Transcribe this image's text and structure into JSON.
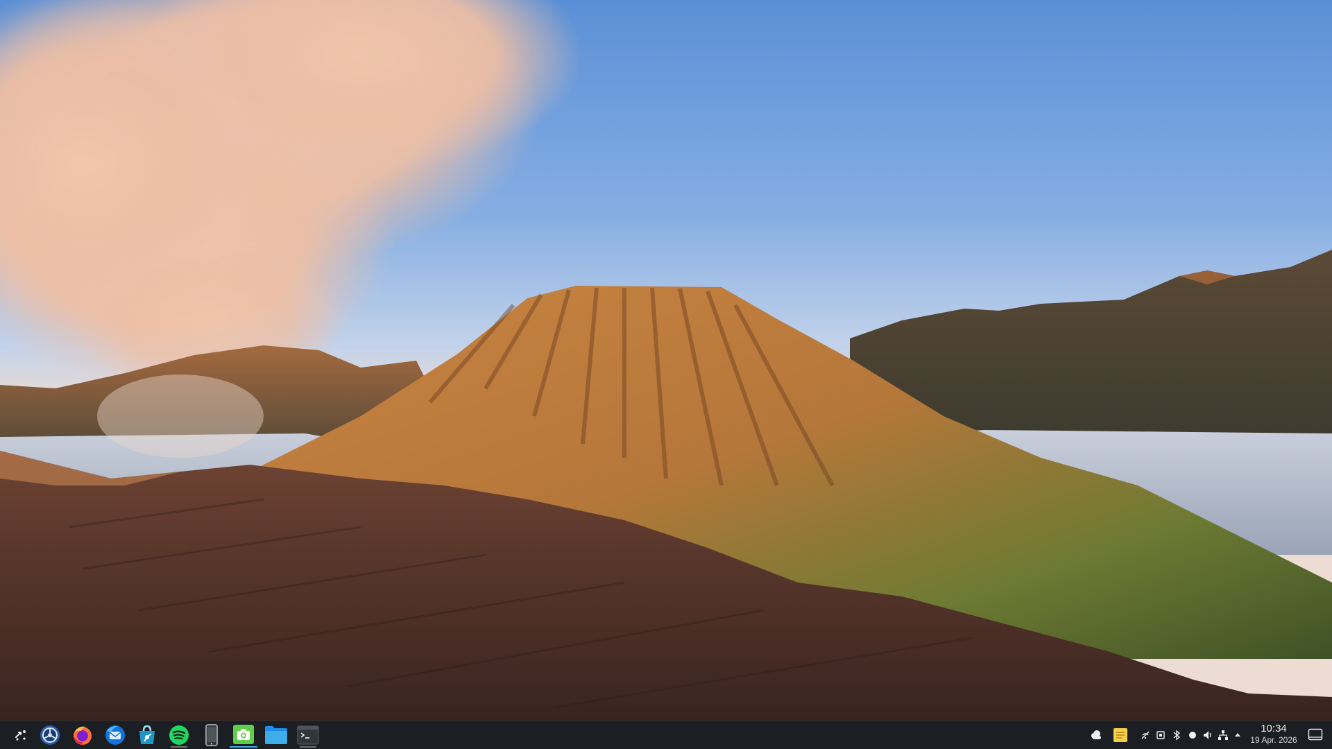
{
  "taskbar": {
    "launchers": [
      {
        "name": "application-launcher",
        "icon": "kde-launcher-icon"
      },
      {
        "name": "system-settings",
        "icon": "system-settings-icon"
      },
      {
        "name": "firefox",
        "icon": "firefox-icon"
      },
      {
        "name": "thunderbird",
        "icon": "thunderbird-icon"
      },
      {
        "name": "discover",
        "icon": "discover-store-icon"
      },
      {
        "name": "spotify",
        "icon": "spotify-icon"
      },
      {
        "name": "kdeconnect",
        "icon": "phone-icon"
      },
      {
        "name": "spectacle",
        "icon": "camera-icon"
      },
      {
        "name": "dolphin",
        "icon": "folder-icon"
      },
      {
        "name": "konsole",
        "icon": "terminal-icon"
      }
    ],
    "tray": [
      {
        "name": "weather",
        "icon": "weather-cloud-icon"
      },
      {
        "name": "notes",
        "icon": "sticky-note-icon"
      },
      {
        "name": "network-disabled",
        "icon": "network-off-icon"
      },
      {
        "name": "devices",
        "icon": "device-icon"
      },
      {
        "name": "bluetooth",
        "icon": "bluetooth-icon"
      },
      {
        "name": "night-color",
        "icon": "brightness-icon"
      },
      {
        "name": "volume",
        "icon": "speaker-icon"
      },
      {
        "name": "network",
        "icon": "network-icon"
      },
      {
        "name": "expand-tray",
        "icon": "chevron-up-icon"
      },
      {
        "name": "show-desktop",
        "icon": "show-desktop-icon"
      }
    ],
    "clock": {
      "time": "10:34",
      "date": "19 Apr. 2026"
    },
    "colors": {
      "panel": "#1b1e22",
      "accent": "#3daee9",
      "text": "#eff0f1"
    }
  }
}
